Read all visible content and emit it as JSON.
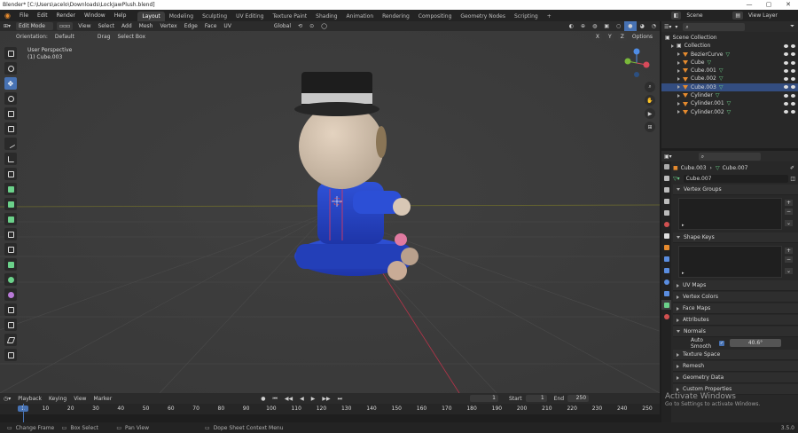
{
  "titlebar": {
    "title": "Blender* [C:\\Users\\acelo\\Downloads\\LockJawPlush.blend]",
    "controls": [
      "—",
      "▢",
      "✕"
    ]
  },
  "menu": {
    "items": [
      "File",
      "Edit",
      "Render",
      "Window",
      "Help"
    ]
  },
  "workspaces": {
    "tabs": [
      "Layout",
      "Modeling",
      "Sculpting",
      "UV Editing",
      "Texture Paint",
      "Shading",
      "Animation",
      "Rendering",
      "Compositing",
      "Geometry Nodes",
      "Scripting"
    ],
    "active": "Layout",
    "add": "+"
  },
  "scene": {
    "label": "Scene",
    "view_layer": "View Layer"
  },
  "header": {
    "mode": "Edit Mode",
    "menus": [
      "View",
      "Select",
      "Add",
      "Mesh",
      "Vertex",
      "Edge",
      "Face",
      "UV"
    ],
    "transform": "Global",
    "options": "Options"
  },
  "header2": {
    "orientation_label": "Orientation:",
    "orientation": "Default",
    "drag": "Drag",
    "select": "Select Box"
  },
  "viewport": {
    "perspective": "User Perspective",
    "object": "(1) Cube.003",
    "gizmo": {
      "x": "X",
      "y": "Y",
      "z": "Z"
    }
  },
  "timeline": {
    "menus": [
      "Playback",
      "Keying",
      "View",
      "Marker"
    ],
    "current_frame": "1",
    "start_label": "Start",
    "start": "1",
    "end_label": "End",
    "end": "250",
    "ruler": [
      "1",
      "10",
      "20",
      "30",
      "40",
      "50",
      "60",
      "70",
      "80",
      "90",
      "100",
      "110",
      "120",
      "130",
      "140",
      "150",
      "160",
      "170",
      "180",
      "190",
      "200",
      "210",
      "220",
      "230",
      "240",
      "250"
    ]
  },
  "status": {
    "items": [
      "Change Frame",
      "Box Select",
      "Pan View",
      "Dope Sheet Context Menu"
    ],
    "version": "3.5.0"
  },
  "outliner": {
    "search_placeholder": "",
    "items": [
      {
        "label": "Scene Collection",
        "indent": 0,
        "kind": "scene"
      },
      {
        "label": "Collection",
        "indent": 1,
        "kind": "collection"
      },
      {
        "label": "BezierCurve",
        "indent": 2,
        "kind": "object"
      },
      {
        "label": "Cube",
        "indent": 2,
        "kind": "object"
      },
      {
        "label": "Cube.001",
        "indent": 2,
        "kind": "object"
      },
      {
        "label": "Cube.002",
        "indent": 2,
        "kind": "object"
      },
      {
        "label": "Cube.003",
        "indent": 2,
        "kind": "object",
        "selected": true
      },
      {
        "label": "Cylinder",
        "indent": 2,
        "kind": "object"
      },
      {
        "label": "Cylinder.001",
        "indent": 2,
        "kind": "object"
      },
      {
        "label": "Cylinder.002",
        "indent": 2,
        "kind": "object"
      }
    ]
  },
  "properties": {
    "breadcrumb_object": "Cube.003",
    "breadcrumb_mesh": "Cube.007",
    "mesh_name": "Cube.007",
    "panels": {
      "vertex_groups": "Vertex Groups",
      "shape_keys": "Shape Keys",
      "uv_maps": "UV Maps",
      "vertex_colors": "Vertex Colors",
      "face_maps": "Face Maps",
      "attributes": "Attributes",
      "normals": "Normals",
      "auto_smooth": "Auto Smooth",
      "auto_smooth_angle": "40.6°",
      "texture_space": "Texture Space",
      "remesh": "Remesh",
      "geometry_data": "Geometry Data",
      "custom_properties": "Custom Properties"
    }
  },
  "watermark": {
    "line1": "Activate Windows",
    "line2": "Go to Settings to activate Windows."
  },
  "colors": {
    "accent": "#4772b3",
    "selected_row": "#334d80",
    "object_orange": "#e58a2e",
    "mesh_green": "#6bd18a"
  }
}
